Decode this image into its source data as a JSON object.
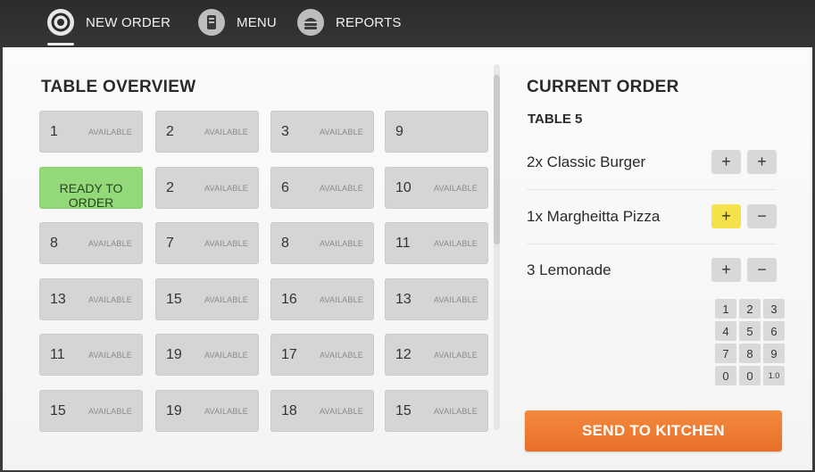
{
  "nav": {
    "items": [
      {
        "label": "NEW ORDER",
        "icon": "target-icon"
      },
      {
        "label": "MENU",
        "icon": "phone-menu-icon"
      },
      {
        "label": "REPORTS",
        "icon": "burger-icon"
      }
    ]
  },
  "tables": {
    "title": "TABLE OVERVIEW",
    "rows": [
      [
        {
          "num": "1",
          "status": "AVAILABLE"
        },
        {
          "num": "2",
          "status": "AVAILABLE"
        },
        {
          "num": "3",
          "status": "AVAILABLE"
        },
        {
          "num": "9",
          "status": ""
        }
      ],
      [
        {
          "label": "READY TO ORDER",
          "ready": true
        },
        {
          "num": "2",
          "status": "AVAILABLE"
        },
        {
          "num": "6",
          "status": "AVAILABLE"
        },
        {
          "num": "10",
          "status": "AVAILABLE"
        }
      ],
      [
        {
          "num": "8",
          "status": "AVAILABLE"
        },
        {
          "num": "7",
          "status": "AVAILABLE"
        },
        {
          "num": "8",
          "status": "AVAILABLE"
        },
        {
          "num": "11",
          "status": "AVAILABLE"
        }
      ],
      [
        {
          "num": "13",
          "status": "AVAILABLE"
        },
        {
          "num": "15",
          "status": "AVAILABLE"
        },
        {
          "num": "16",
          "status": "AVAILABLE"
        },
        {
          "num": "13",
          "status": "AVAILABLE"
        }
      ],
      [
        {
          "num": "11",
          "status": "AVAILABLE"
        },
        {
          "num": "19",
          "status": "AVAILABLE"
        },
        {
          "num": "17",
          "status": "AVAILABLE"
        },
        {
          "num": "12",
          "status": "AVAILABLE"
        }
      ],
      [
        {
          "num": "15",
          "status": "AVAILABLE"
        },
        {
          "num": "19",
          "status": "AVAILABLE"
        },
        {
          "num": "18",
          "status": "AVAILABLE"
        },
        {
          "num": "15",
          "status": "AVAILABLE"
        }
      ]
    ]
  },
  "order": {
    "title": "CURRENT ORDER",
    "table_label": "TABLE 5",
    "items": [
      {
        "text": "2x Classic Burger",
        "btn1": "+",
        "btn2": "+",
        "btn1_yellow": false
      },
      {
        "text": "1x Margheitta Pizza",
        "btn1": "+",
        "btn2": "−",
        "btn1_yellow": true
      },
      {
        "text": "3  Lemonade",
        "btn1": "+",
        "btn2": "−",
        "btn1_yellow": false
      }
    ],
    "keypad": [
      [
        "1",
        "2",
        "3"
      ],
      [
        "4",
        "5",
        "6"
      ],
      [
        "7",
        "8",
        "9"
      ],
      [
        "0",
        "0",
        "1.0"
      ]
    ],
    "send_label": "SEND TO KITCHEN"
  },
  "colors": {
    "ready": "#93d97a",
    "accent": "#ee7b30",
    "highlight": "#f5e24a"
  }
}
